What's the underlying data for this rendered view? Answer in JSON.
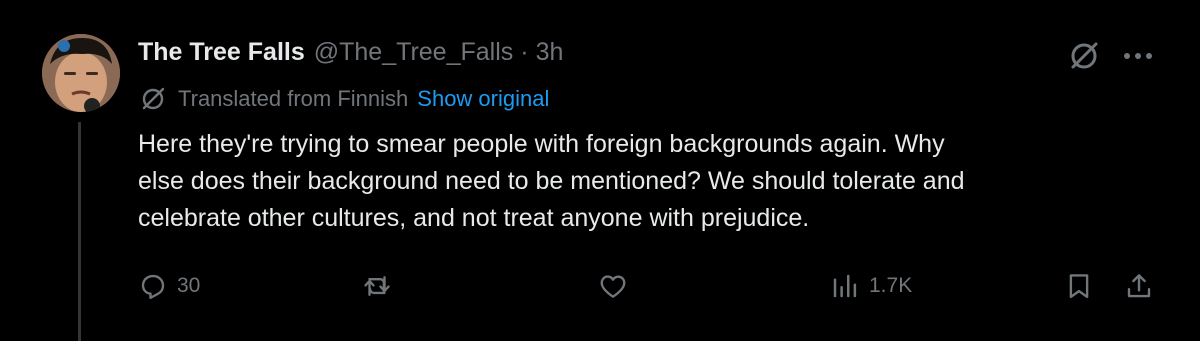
{
  "tweet": {
    "author": {
      "display_name": "The Tree Falls",
      "handle": "@The_Tree_Falls"
    },
    "separator": "·",
    "timestamp": "3h",
    "translation": {
      "label": "Translated from Finnish",
      "show_original": "Show original"
    },
    "text": "Here they're trying to smear people with foreign backgrounds again. Why\nelse does their background need to be mentioned? We should tolerate and\ncelebrate other cultures, and not treat anyone with prejudice.",
    "metrics": {
      "replies": "30",
      "views": "1.7K"
    }
  },
  "icons": {
    "grok": "grok-icon",
    "more": "more-icon",
    "translate": "translate-icon",
    "reply": "reply-icon",
    "retweet": "retweet-icon",
    "like": "heart-icon",
    "views": "views-icon",
    "bookmark": "bookmark-icon",
    "share": "share-icon"
  },
  "colors": {
    "background": "#000000",
    "primary_text": "#e7e9ea",
    "secondary_text": "#71767b",
    "link": "#1d9bf0",
    "thread_line": "#333639"
  }
}
